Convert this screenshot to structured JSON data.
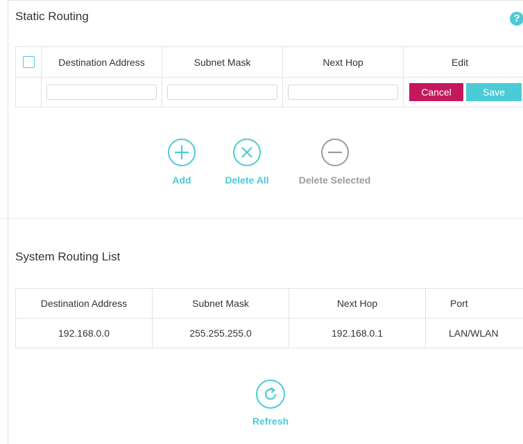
{
  "static_routing": {
    "title": "Static Routing",
    "help_icon": "?",
    "columns": [
      "Destination Address",
      "Subnet Mask",
      "Next Hop",
      "Edit"
    ],
    "edit_row": {
      "destination_value": "",
      "subnet_value": "",
      "nexthop_value": "",
      "cancel_label": "Cancel",
      "save_label": "Save"
    }
  },
  "actions": {
    "add": "Add",
    "delete_all": "Delete All",
    "delete_selected": "Delete Selected"
  },
  "system_routing": {
    "title": "System Routing List",
    "columns": [
      "Destination Address",
      "Subnet Mask",
      "Next Hop",
      "Port"
    ],
    "rows": [
      {
        "destination": "192.168.0.0",
        "subnet": "255.255.255.0",
        "next_hop": "192.168.0.1",
        "port": "LAN/WLAN"
      }
    ]
  },
  "refresh_label": "Refresh",
  "colors": {
    "accent": "#4acbd6",
    "cancel": "#c5175e",
    "disabled": "#9b9b9b"
  },
  "icons": [
    "help-icon",
    "add-icon",
    "delete-all-icon",
    "delete-selected-icon",
    "refresh-icon"
  ]
}
